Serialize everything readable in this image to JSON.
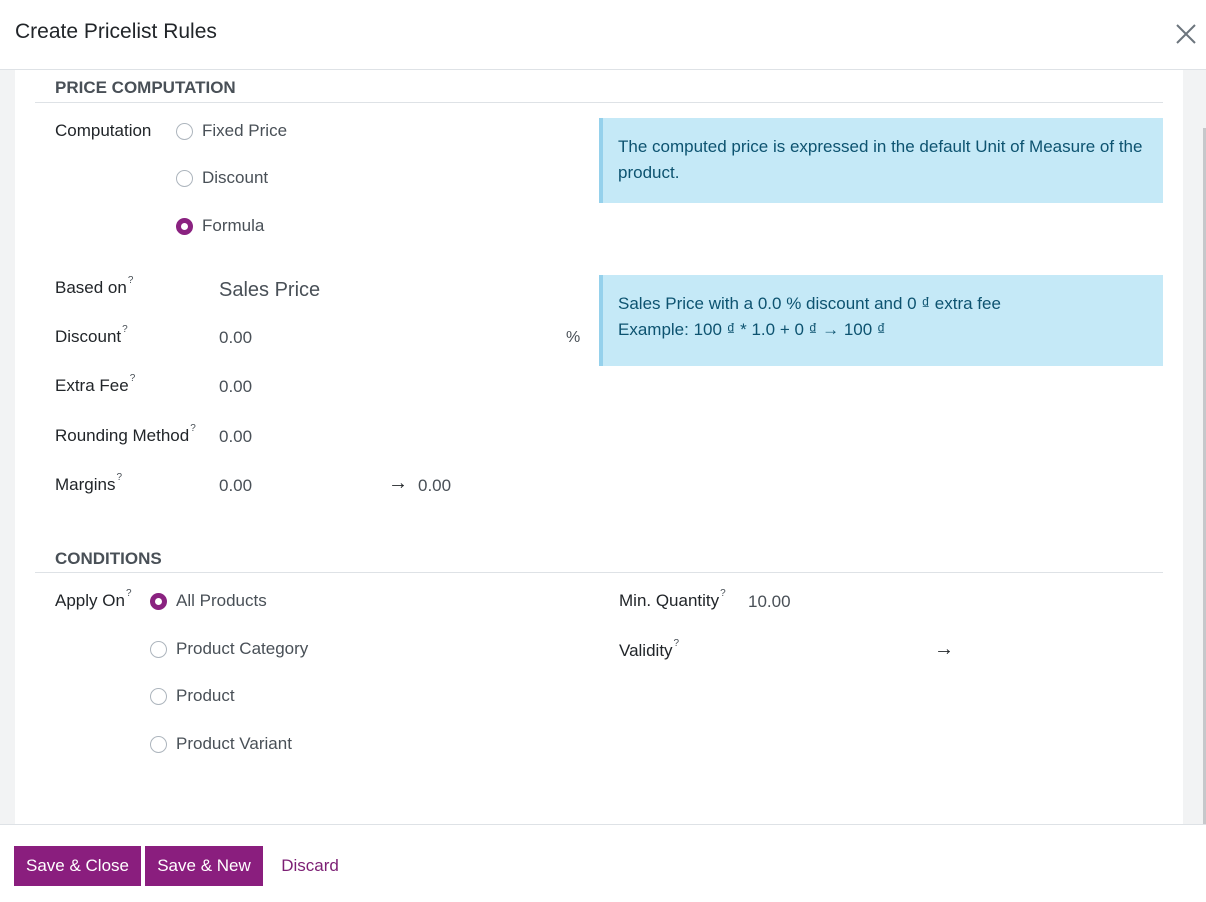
{
  "dialog": {
    "title": "Create Pricelist Rules"
  },
  "price_computation": {
    "section_title": "PRICE COMPUTATION",
    "computation_label": "Computation",
    "options": [
      {
        "label": "Fixed Price",
        "checked": false
      },
      {
        "label": "Discount",
        "checked": false
      },
      {
        "label": "Formula",
        "checked": true
      }
    ],
    "info_uom": "The computed price is expressed in the default Unit of Measure of the product.",
    "based_on": {
      "label": "Based on",
      "help": "?",
      "value": "Sales Price"
    },
    "discount": {
      "label": "Discount",
      "help": "?",
      "value": "0.00",
      "unit": "%"
    },
    "extra_fee": {
      "label": "Extra Fee",
      "help": "?",
      "value": "0.00"
    },
    "rounding": {
      "label": "Rounding Method",
      "help": "?",
      "value": "0.00"
    },
    "margins": {
      "label": "Margins",
      "help": "?",
      "min": "0.00",
      "arrow": "→",
      "max": "0.00"
    },
    "example_line1": "Sales Price with a 0.0 % discount and 0 ₫ extra fee",
    "example_line2": "Example: 100 ₫ * 1.0 + 0 ₫ → 100 ₫"
  },
  "conditions": {
    "section_title": "CONDITIONS",
    "apply_on": {
      "label": "Apply On",
      "help": "?"
    },
    "options": [
      {
        "label": "All Products",
        "checked": true
      },
      {
        "label": "Product Category",
        "checked": false
      },
      {
        "label": "Product",
        "checked": false
      },
      {
        "label": "Product Variant",
        "checked": false
      }
    ],
    "min_qty": {
      "label": "Min. Quantity",
      "help": "?",
      "value": "10.00"
    },
    "validity": {
      "label": "Validity",
      "help": "?",
      "arrow": "→"
    }
  },
  "footer": {
    "save_close": "Save & Close",
    "save_new": "Save & New",
    "discard": "Discard"
  },
  "colors": {
    "primary": "#8a1e7e",
    "info_bg": "#c5e9f7",
    "info_text": "#0d5370"
  }
}
